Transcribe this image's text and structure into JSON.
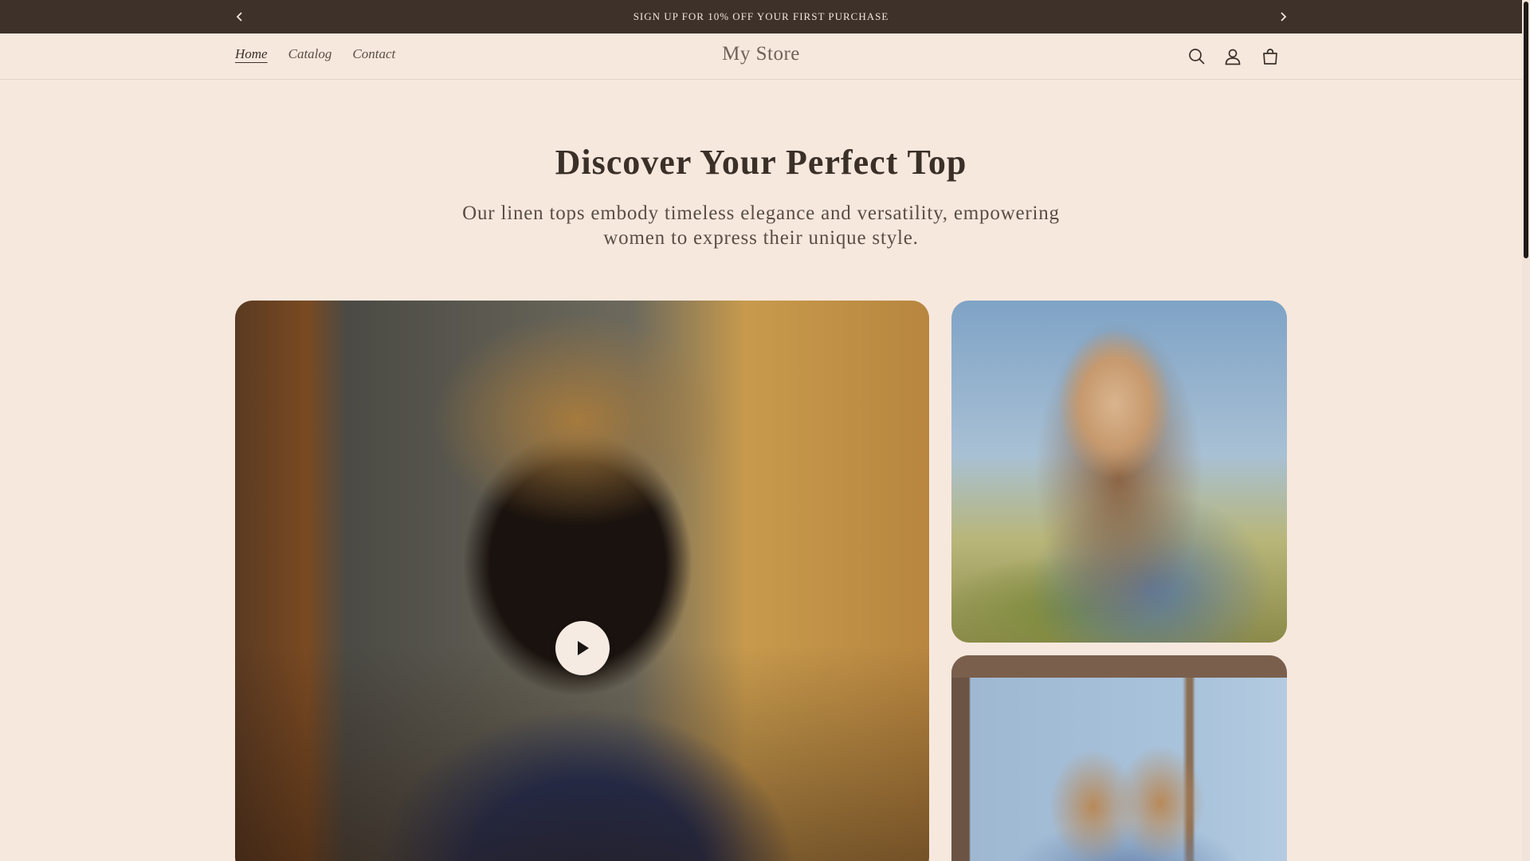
{
  "announcement": {
    "text": "SIGN UP FOR 10% OFF YOUR FIRST PURCHASE",
    "prev_icon": "chevron-left-icon",
    "next_icon": "chevron-right-icon"
  },
  "header": {
    "store_name": "My Store",
    "nav": [
      {
        "label": "Home",
        "active": true
      },
      {
        "label": "Catalog",
        "active": false
      },
      {
        "label": "Contact",
        "active": false
      }
    ],
    "icons": [
      "search-icon",
      "account-icon",
      "cart-icon"
    ]
  },
  "hero": {
    "title": "Discover Your Perfect Top",
    "subtitle": "Our linen tops embody timeless elegance and versatility, empowering women to express their unique style."
  },
  "media": {
    "play_icon": "play-icon"
  },
  "colors": {
    "background": "#f7e8dd",
    "announcement_bar": "#3d3129",
    "text": "#3b3028"
  }
}
